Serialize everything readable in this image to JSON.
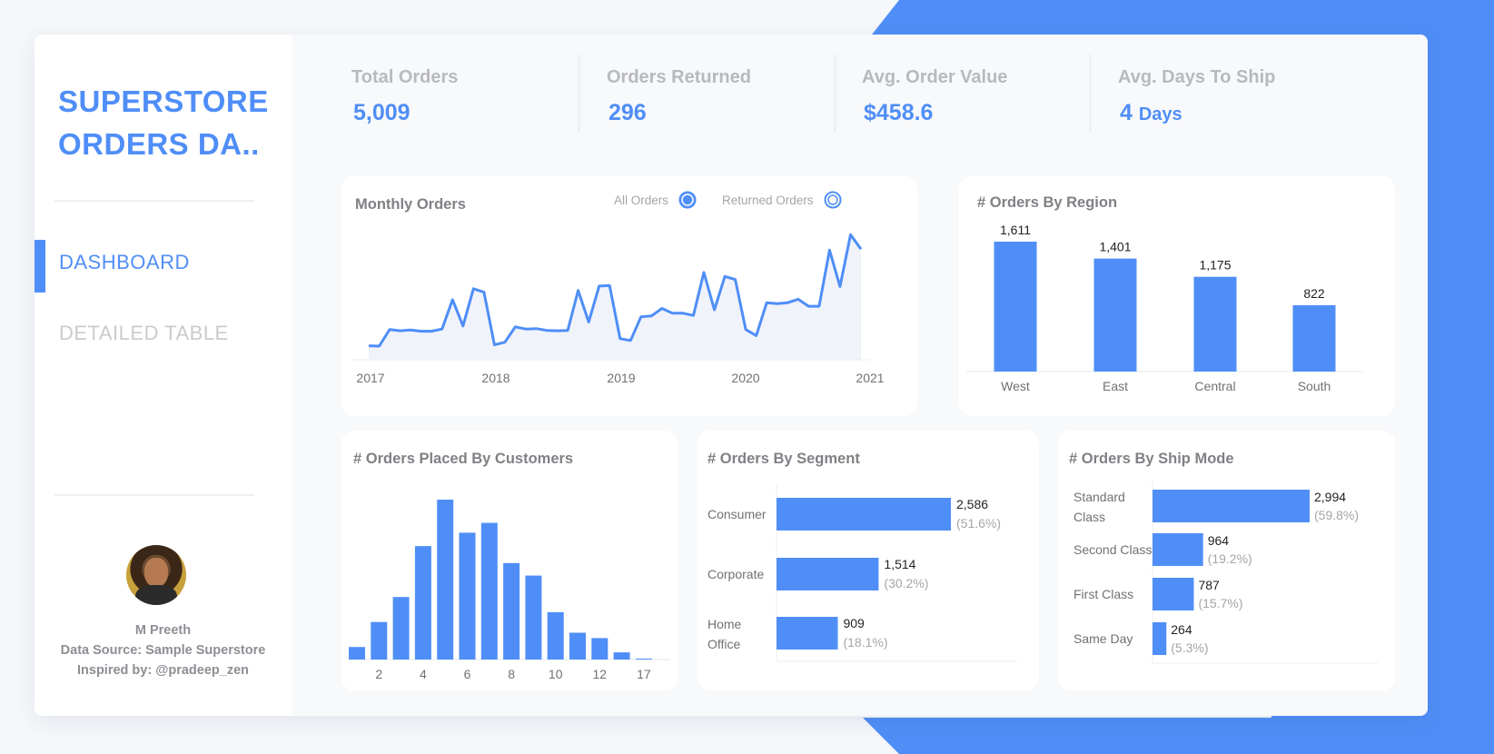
{
  "colors": {
    "accent": "#4f8ef7",
    "muted": "#b7b9bd",
    "text": "#7f8185"
  },
  "sidebar": {
    "title": "SUPERSTORE ORDERS DA..",
    "nav": [
      {
        "label": "DASHBOARD",
        "active": true
      },
      {
        "label": "DETAILED TABLE",
        "active": false
      }
    ],
    "author": "M Preeth",
    "source": "Data Source: Sample Superstore",
    "inspired": "Inspired by: @pradeep_zen"
  },
  "kpis": [
    {
      "label": "Total Orders",
      "value": "5,009"
    },
    {
      "label": "Orders Returned",
      "value": "296"
    },
    {
      "label": "Avg. Order Value",
      "value": "$458.6"
    },
    {
      "label": "Avg. Days To Ship",
      "value": "4",
      "unit": "Days"
    }
  ],
  "chart_data": [
    {
      "type": "line",
      "title": "Monthly Orders",
      "legend": [
        "All Orders",
        "Returned Orders"
      ],
      "x_ticks": [
        "2017",
        "2018",
        "2019",
        "2020",
        "2021"
      ],
      "series": [
        {
          "name": "All Orders",
          "values": [
            32,
            31,
            69,
            66,
            68,
            65,
            65,
            70,
            137,
            77,
            162,
            154,
            34,
            40,
            75,
            70,
            71,
            67,
            66,
            67,
            158,
            86,
            168,
            169,
            48,
            44,
            98,
            100,
            117,
            106,
            106,
            101,
            199,
            114,
            190,
            183,
            69,
            55,
            130,
            128,
            130,
            138,
            122,
            122,
            250,
            167,
            285,
            252
          ]
        }
      ]
    },
    {
      "type": "bar",
      "title": "# Orders By Region",
      "categories": [
        "West",
        "East",
        "Central",
        "South"
      ],
      "values": [
        1611,
        1401,
        1175,
        822
      ],
      "value_labels": [
        "1,611",
        "1,401",
        "1,175",
        "822"
      ]
    },
    {
      "type": "bar",
      "title": "# Orders Placed By Customers",
      "x": [
        1,
        2,
        3,
        4,
        5,
        6,
        7,
        8,
        9,
        10,
        11,
        12,
        13,
        14
      ],
      "values": [
        14,
        42,
        70,
        127,
        179,
        142,
        153,
        108,
        94,
        53,
        30,
        24,
        8,
        1
      ],
      "tick_labels": [
        "2",
        "4",
        "6",
        "8",
        "10",
        "12",
        "17"
      ]
    },
    {
      "type": "bar",
      "title": "# Orders By Segment",
      "categories": [
        "Consumer",
        "Corporate",
        "Home Office"
      ],
      "values": [
        2586,
        1514,
        909
      ],
      "value_labels": [
        "2,586",
        "1,514",
        "909"
      ],
      "percent_labels": [
        "(51.6%)",
        "(30.2%)",
        "(18.1%)"
      ]
    },
    {
      "type": "bar",
      "title": "# Orders By Ship Mode",
      "categories": [
        "Standard Class",
        "Second Class",
        "First Class",
        "Same Day"
      ],
      "values": [
        2994,
        964,
        787,
        264
      ],
      "value_labels": [
        "2,994",
        "964",
        "787",
        "264"
      ],
      "percent_labels": [
        "(59.8%)",
        "(19.2%)",
        "(15.7%)",
        "(5.3%)"
      ]
    }
  ]
}
